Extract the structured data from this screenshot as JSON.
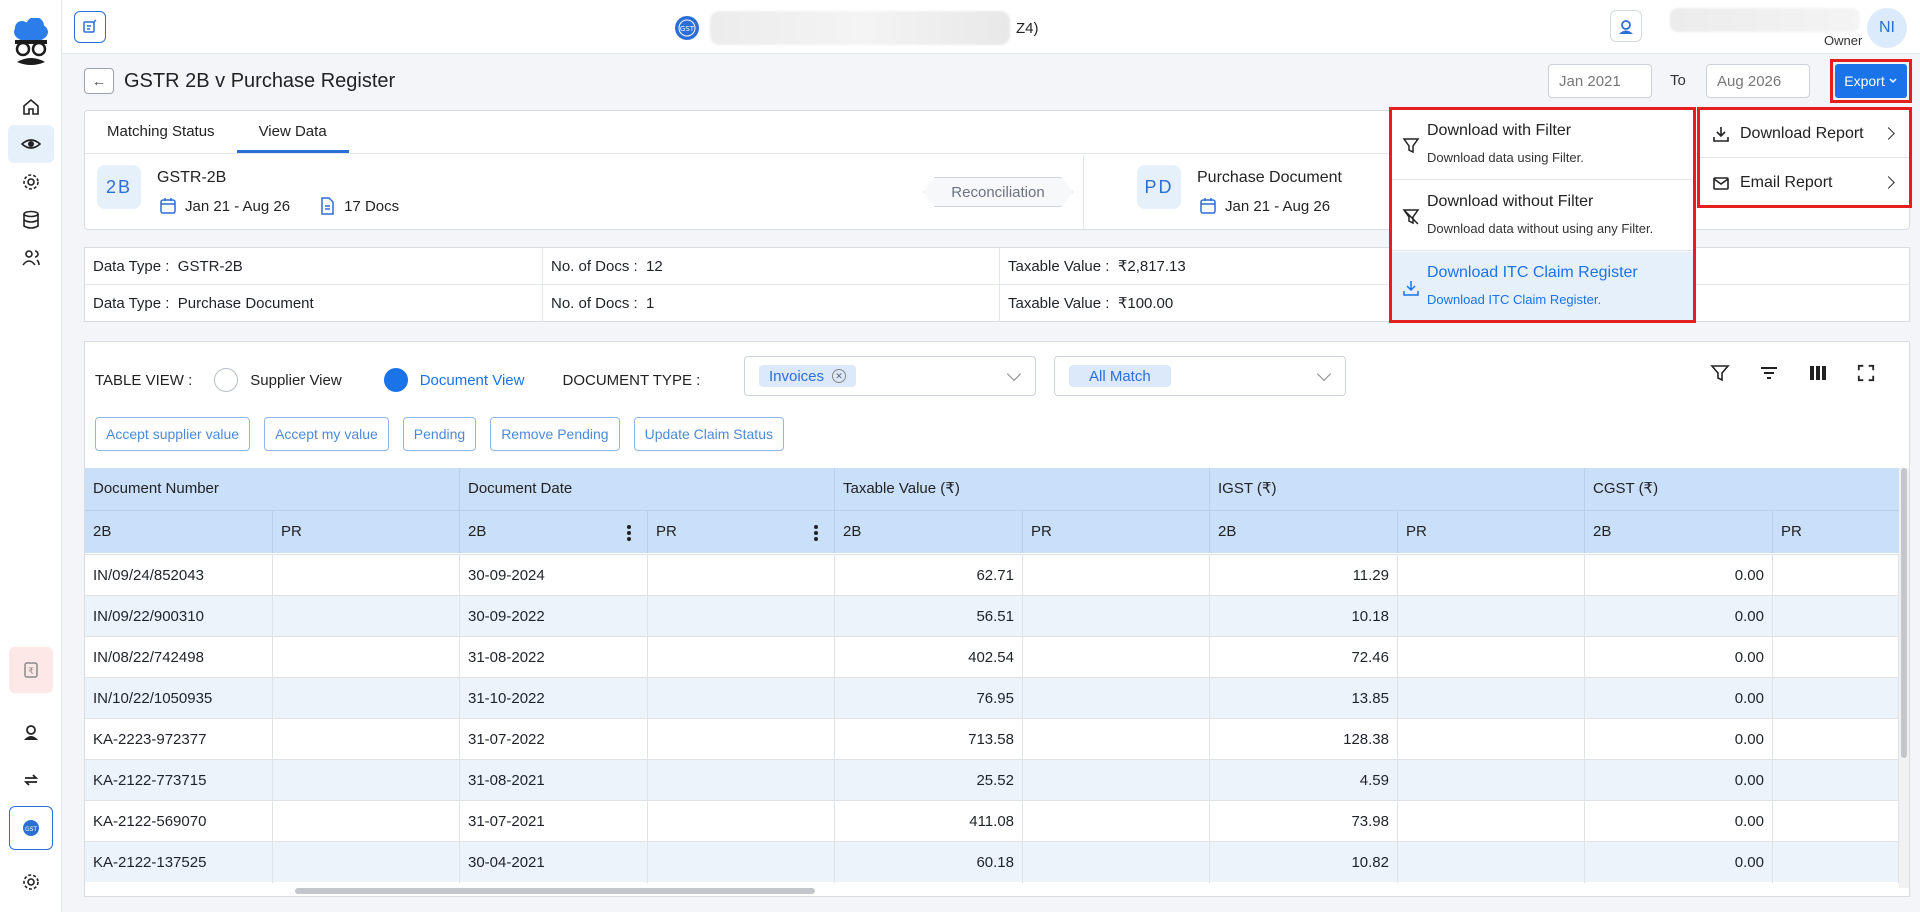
{
  "header": {
    "company_suffix": "Z4)",
    "user_role": "Owner",
    "avatar_initials": "NI"
  },
  "page": {
    "title": "GSTR 2B v Purchase Register",
    "back_label": "←",
    "date_from": "Jan 2021",
    "to_label": "To",
    "date_to": "Aug 2026",
    "export_label": "Export"
  },
  "tabs": [
    {
      "label": "Matching Status"
    },
    {
      "label": "View Data"
    }
  ],
  "summary": {
    "left": {
      "badge": "2B",
      "name": "GSTR-2B",
      "period": "Jan 21 - Aug 26",
      "docs": "17 Docs"
    },
    "center_label": "Reconciliation",
    "right": {
      "badge": "PD",
      "name": "Purchase Document",
      "period": "Jan 21 - Aug 26"
    }
  },
  "info": {
    "rows": [
      {
        "type_label": "Data Type :",
        "type_value": "GSTR-2B",
        "docs_label": "No. of Docs :",
        "docs_value": "12",
        "taxable_label": "Taxable Value :",
        "taxable_value": "₹2,817.13"
      },
      {
        "type_label": "Data Type :",
        "type_value": "Purchase Document",
        "docs_label": "No. of Docs :",
        "docs_value": "1",
        "taxable_label": "Taxable Value :",
        "taxable_value": "₹100.00"
      }
    ]
  },
  "toolbar": {
    "table_view_label": "TABLE VIEW :",
    "supplier_view": "Supplier View",
    "document_view": "Document View",
    "doc_type_label": "DOCUMENT TYPE :",
    "doc_type_chip": "Invoices",
    "match_chip": "All Match"
  },
  "actions": [
    "Accept supplier value",
    "Accept my value",
    "Pending",
    "Remove Pending",
    "Update Claim Status"
  ],
  "grid": {
    "groups": [
      "Document Number",
      "Document Date",
      "Taxable Value (₹)",
      "IGST (₹)",
      "CGST (₹)"
    ],
    "sub": [
      "2B",
      "PR",
      "2B",
      "PR",
      "2B",
      "PR",
      "2B",
      "PR",
      "2B",
      "PR"
    ],
    "rows": [
      {
        "doc": "IN/09/24/852043",
        "date": "30-09-2024",
        "taxable": "62.71",
        "igst": "11.29",
        "cgst": "0.00"
      },
      {
        "doc": "IN/09/22/900310",
        "date": "30-09-2022",
        "taxable": "56.51",
        "igst": "10.18",
        "cgst": "0.00"
      },
      {
        "doc": "IN/08/22/742498",
        "date": "31-08-2022",
        "taxable": "402.54",
        "igst": "72.46",
        "cgst": "0.00"
      },
      {
        "doc": "IN/10/22/1050935",
        "date": "31-10-2022",
        "taxable": "76.95",
        "igst": "13.85",
        "cgst": "0.00"
      },
      {
        "doc": "KA-2223-972377",
        "date": "31-07-2022",
        "taxable": "713.58",
        "igst": "128.38",
        "cgst": "0.00"
      },
      {
        "doc": "KA-2122-773715",
        "date": "31-08-2021",
        "taxable": "25.52",
        "igst": "4.59",
        "cgst": "0.00"
      },
      {
        "doc": "KA-2122-569070",
        "date": "31-07-2021",
        "taxable": "411.08",
        "igst": "73.98",
        "cgst": "0.00"
      },
      {
        "doc": "KA-2122-137525",
        "date": "30-04-2021",
        "taxable": "60.18",
        "igst": "10.82",
        "cgst": "0.00"
      }
    ]
  },
  "export_menu": {
    "items": [
      {
        "title": "Download with Filter",
        "subtitle": "Download data using Filter."
      },
      {
        "title": "Download without Filter",
        "subtitle": "Download data without using any Filter."
      },
      {
        "title": "Download ITC Claim Register",
        "subtitle": "Download ITC Claim Register."
      }
    ],
    "submenu": [
      {
        "label": "Download Report"
      },
      {
        "label": "Email Report"
      }
    ]
  },
  "colors": {
    "accent": "#1a73e8",
    "highlight": "#e41f1f",
    "header_bg": "#c9dffa"
  }
}
